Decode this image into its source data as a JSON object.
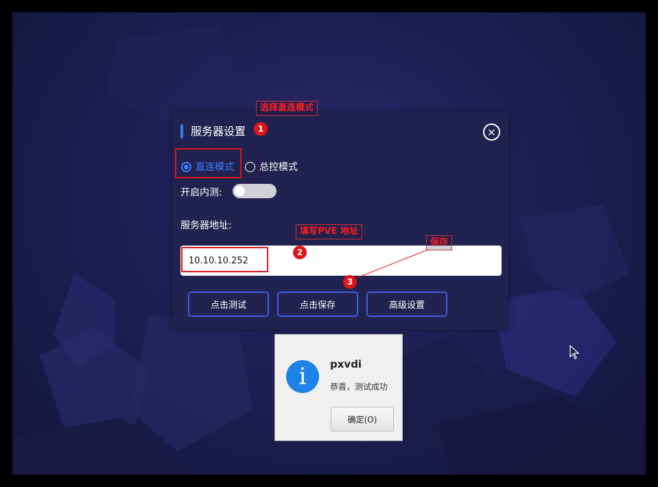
{
  "dialog": {
    "title": "服务器设置",
    "close_glyph": "×",
    "mode_direct": "直连模式",
    "mode_central": "总控模式",
    "internal_test_label": "开启内测:",
    "internal_test_on": false,
    "server_address_label": "服务器地址:",
    "server_address_value": "10.10.10.252",
    "buttons": {
      "test": "点击测试",
      "save": "点击保存",
      "advanced": "高级设置"
    }
  },
  "annotations": {
    "step1_note": "选择直连模式",
    "step2_note": "填写PVE 地址",
    "step3_note": "保存",
    "badge1": "1",
    "badge2": "2",
    "badge3": "3"
  },
  "message_box": {
    "icon": "info-icon",
    "title": "pxvdi",
    "text": "恭喜，测试成功",
    "ok_label": "确定(O)"
  },
  "colors": {
    "accent_blue": "#3d7eff",
    "annotation_red": "#e0141b",
    "dialog_bg": "#222250",
    "info_blue": "#1e82e6"
  }
}
